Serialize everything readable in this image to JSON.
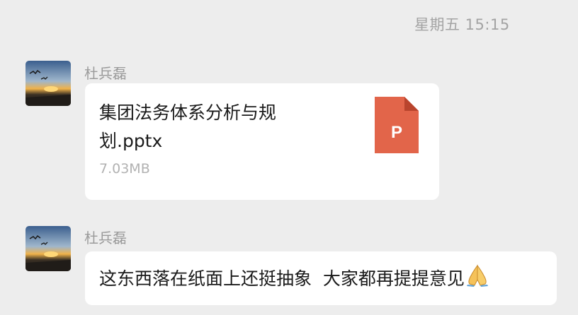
{
  "timestamp": "星期五 15:15",
  "messages": [
    {
      "sender": "杜兵磊",
      "type": "file",
      "file": {
        "name": "集团法务体系分析与规划.pptx",
        "size": "7.03MB",
        "icon": "pptx-file-icon",
        "icon_letter": "P",
        "icon_color": "#e2654a"
      }
    },
    {
      "sender": "杜兵磊",
      "type": "text",
      "text": "这东西落在纸面上还挺抽象  大家都再提提意见",
      "emoji": "folded-hands-emoji"
    }
  ]
}
